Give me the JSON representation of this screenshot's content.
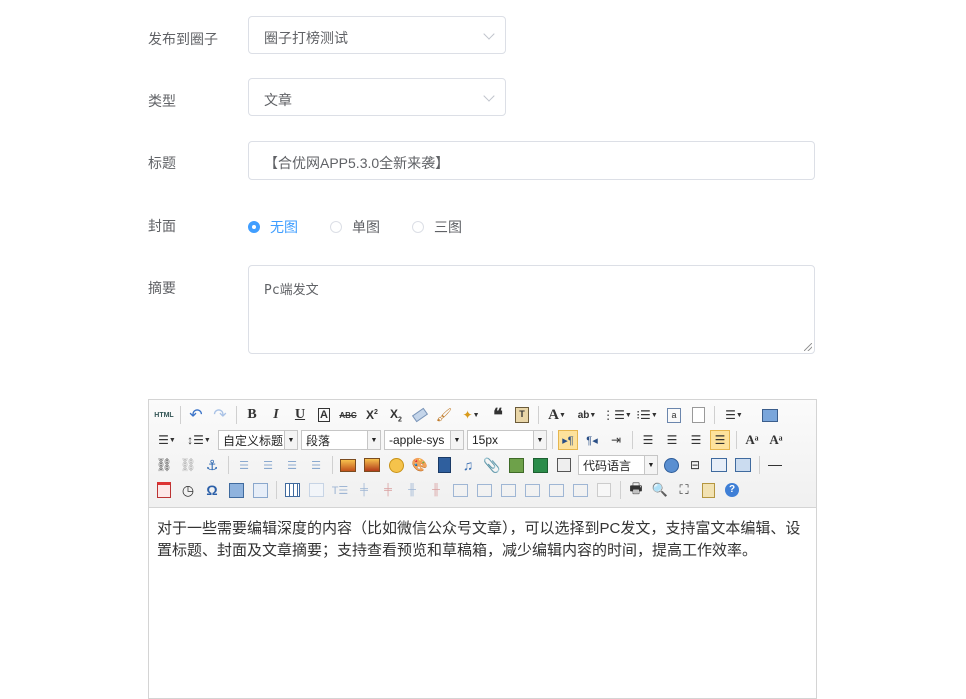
{
  "form": {
    "circle": {
      "label": "发布到圈子",
      "value": "圈子打榜测试"
    },
    "type": {
      "label": "类型",
      "value": "文章"
    },
    "title": {
      "label": "标题",
      "value": "【合优网APP5.3.0全新来袭】"
    },
    "cover": {
      "label": "封面",
      "options": [
        "无图",
        "单图",
        "三图"
      ],
      "selected": "无图"
    },
    "summary": {
      "label": "摘要",
      "value": "Pc端发文"
    }
  },
  "editor": {
    "toolbar": {
      "custom_heading": "自定义标题",
      "paragraph": "段落",
      "font_family": "-apple-sys",
      "font_size": "15px",
      "code_language": "代码语言"
    },
    "content": "对于一些需要编辑深度的内容（比如微信公众号文章），可以选择到PC发文，支持富文本编辑、设置标题、封面及文章摘要；支持查看预览和草稿箱，减少编辑内容的时间，提高工作效率。"
  },
  "colors": {
    "accent": "#409eff",
    "border": "#dcdfe6",
    "text": "#606266"
  }
}
